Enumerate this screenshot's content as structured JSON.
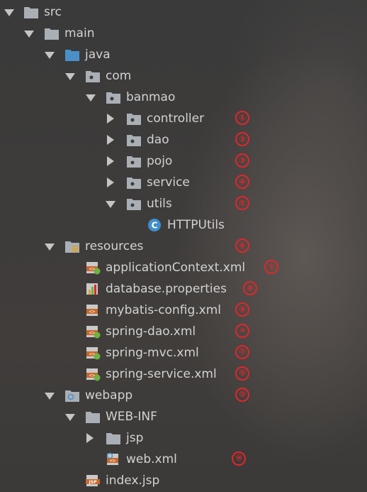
{
  "tree": [
    {
      "label": "src",
      "expanded": true,
      "icon": "folder-plain-icon"
    },
    {
      "label": "main",
      "expanded": true,
      "icon": "folder-plain-icon"
    },
    {
      "label": "java",
      "expanded": true,
      "icon": "folder-source-icon"
    },
    {
      "label": "com",
      "expanded": true,
      "icon": "package-icon"
    },
    {
      "label": "banmao",
      "expanded": true,
      "icon": "package-icon"
    },
    {
      "label": "controller",
      "expanded": false,
      "icon": "package-icon",
      "badge": "①"
    },
    {
      "label": "dao",
      "expanded": false,
      "icon": "package-icon",
      "badge": "②"
    },
    {
      "label": "pojo",
      "expanded": false,
      "icon": "package-icon",
      "badge": "③"
    },
    {
      "label": "service",
      "expanded": false,
      "icon": "package-icon",
      "badge": "④"
    },
    {
      "label": "utils",
      "expanded": true,
      "icon": "package-icon",
      "badge": "⑤"
    },
    {
      "label": "HTTPUtils",
      "icon": "java-class-icon"
    },
    {
      "label": "resources",
      "expanded": true,
      "icon": "resources-folder-icon",
      "badge": "⑥"
    },
    {
      "label": "applicationContext.xml",
      "icon": "spring-xml-icon",
      "badge": "⑦"
    },
    {
      "label": "database.properties",
      "icon": "properties-file-icon",
      "badge": "⑧"
    },
    {
      "label": "mybatis-config.xml",
      "icon": "xml-file-icon",
      "badge": "⑨"
    },
    {
      "label": "spring-dao.xml",
      "icon": "spring-xml-icon",
      "badge": "⑩"
    },
    {
      "label": "spring-mvc.xml",
      "icon": "spring-xml-icon",
      "badge": "⑪"
    },
    {
      "label": "spring-service.xml",
      "icon": "spring-xml-icon",
      "badge": "⑫"
    },
    {
      "label": "webapp",
      "expanded": true,
      "icon": "web-folder-icon",
      "badge": "⑬"
    },
    {
      "label": "WEB-INF",
      "expanded": true,
      "icon": "folder-plain-icon"
    },
    {
      "label": "jsp",
      "expanded": false,
      "icon": "folder-plain-icon"
    },
    {
      "label": "web.xml",
      "icon": "web-xml-icon",
      "badge": "⑭"
    },
    {
      "label": "index.jsp",
      "icon": "jsp-file-icon"
    }
  ],
  "colors": {
    "badge": "#e0262a",
    "folder": "#a9afb5",
    "source_folder": "#4a90c8",
    "java_class": "#3f8fcf"
  }
}
